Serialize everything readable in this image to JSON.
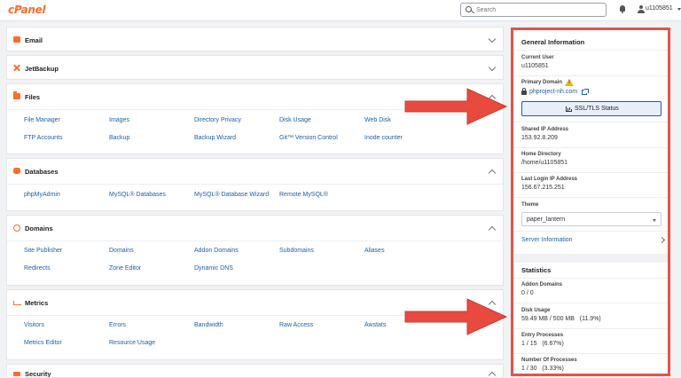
{
  "header": {
    "logo": "cPanel",
    "search_placeholder": "Search",
    "username": "u1105851"
  },
  "panels": [
    {
      "id": "email",
      "title": "Email",
      "icon": "envelope-icon",
      "expanded": false,
      "rows": []
    },
    {
      "id": "jetbackup",
      "title": "JetBackup",
      "icon": "jetbackup-icon",
      "expanded": false,
      "rows": []
    },
    {
      "id": "files",
      "title": "Files",
      "icon": "folder-icon",
      "expanded": true,
      "rows": [
        [
          "File Manager",
          "Images",
          "Directory Privacy",
          "Disk Usage",
          "Web Disk"
        ],
        [
          "FTP Accounts",
          "Backup",
          "Backup Wizard",
          "Git™ Version Control",
          "Inode counter"
        ]
      ]
    },
    {
      "id": "databases",
      "title": "Databases",
      "icon": "database-icon",
      "expanded": true,
      "rows": [
        [
          "phpMyAdmin",
          "MySQL® Databases",
          "MySQL® Database Wizard",
          "Remote MySQL®"
        ]
      ]
    },
    {
      "id": "domains",
      "title": "Domains",
      "icon": "globe-icon",
      "expanded": true,
      "rows": [
        [
          "Site Publisher",
          "Domains",
          "Addon Domains",
          "Subdomains",
          "Aliases"
        ],
        [
          "Redirects",
          "Zone Editor",
          "Dynamic DNS"
        ]
      ]
    },
    {
      "id": "metrics",
      "title": "Metrics",
      "icon": "chart-icon",
      "expanded": true,
      "rows": [
        [
          "Visitors",
          "Errors",
          "Bandwidth",
          "Raw Access",
          "Awstats"
        ],
        [
          "Metrics Editor",
          "Resource Usage"
        ]
      ]
    },
    {
      "id": "security",
      "title": "Security",
      "icon": "lock-icon",
      "expanded": true,
      "rows": []
    }
  ],
  "sidebar": {
    "general_title": "General Information",
    "current_user_label": "Current User",
    "current_user": "u1105851",
    "primary_domain_label": "Primary Domain",
    "primary_domain": "phproject-nh.com",
    "ssl_button": "SSL/TLS Status",
    "shared_ip_label": "Shared IP Address",
    "shared_ip": "153.92.8.209",
    "home_dir_label": "Home Directory",
    "home_dir": "/home/u1105851",
    "last_login_label": "Last Login IP Address",
    "last_login": "156.67.215.251",
    "theme_label": "Theme",
    "theme": "paper_lantern",
    "server_info": "Server Information",
    "stats_title": "Statistics",
    "addon_domains_label": "Addon Domains",
    "addon_domains": "0 / 0",
    "disk_usage_label": "Disk Usage",
    "disk_usage": "59.49 MB / 500 MB   (11.9%)",
    "entry_processes_label": "Entry Processes",
    "entry_processes": "1 / 15   (6.67%)",
    "num_processes_label": "Number Of Processes",
    "num_processes": "1 / 30   (3.33%)"
  },
  "colors": {
    "accent": "#ff6c2c",
    "link": "#1d5fa5",
    "highlight": "#e5524a"
  }
}
